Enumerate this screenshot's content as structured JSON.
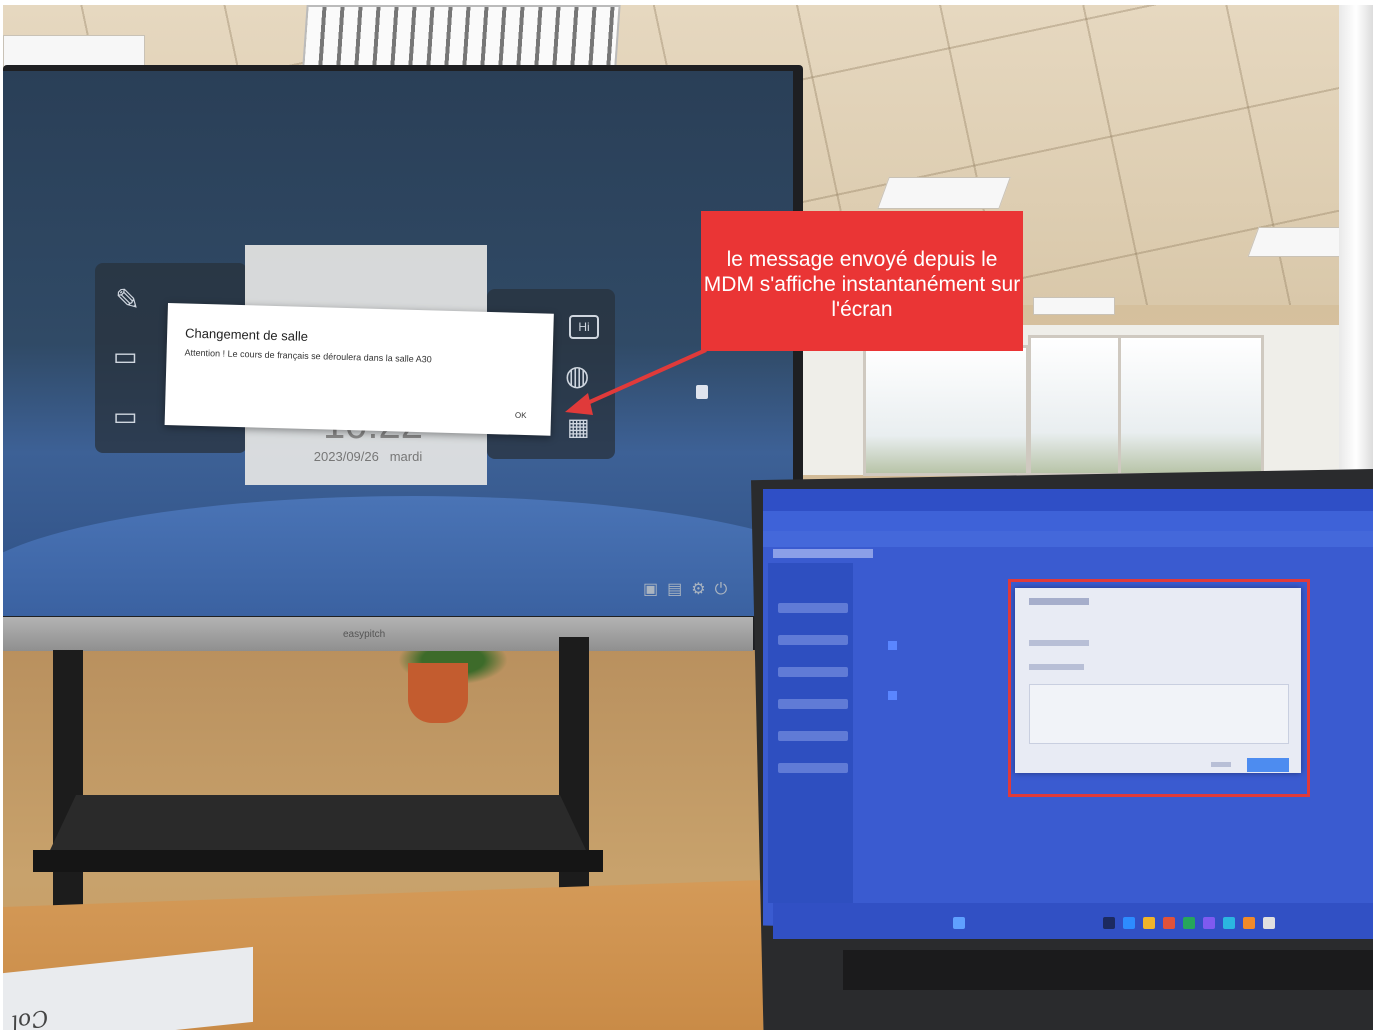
{
  "annotation": {
    "callout_text": "le message envoyé depuis le MDM s'affiche instantanément sur l'écran",
    "callout_color": "#ea3535",
    "arrow_color": "#e03a3a",
    "highlight_box_color": "#e03a3a"
  },
  "board": {
    "brand": "easypitch",
    "date": "2023/09/26",
    "weekday": "mardi",
    "time_fragment": "10:22",
    "side_badge": "Hi",
    "dialog": {
      "title": "Changement de salle",
      "message": "Attention ! Le cours de français se déroulera dans la salle A30",
      "ok_button": "OK"
    }
  },
  "paper": {
    "text": "Col"
  }
}
